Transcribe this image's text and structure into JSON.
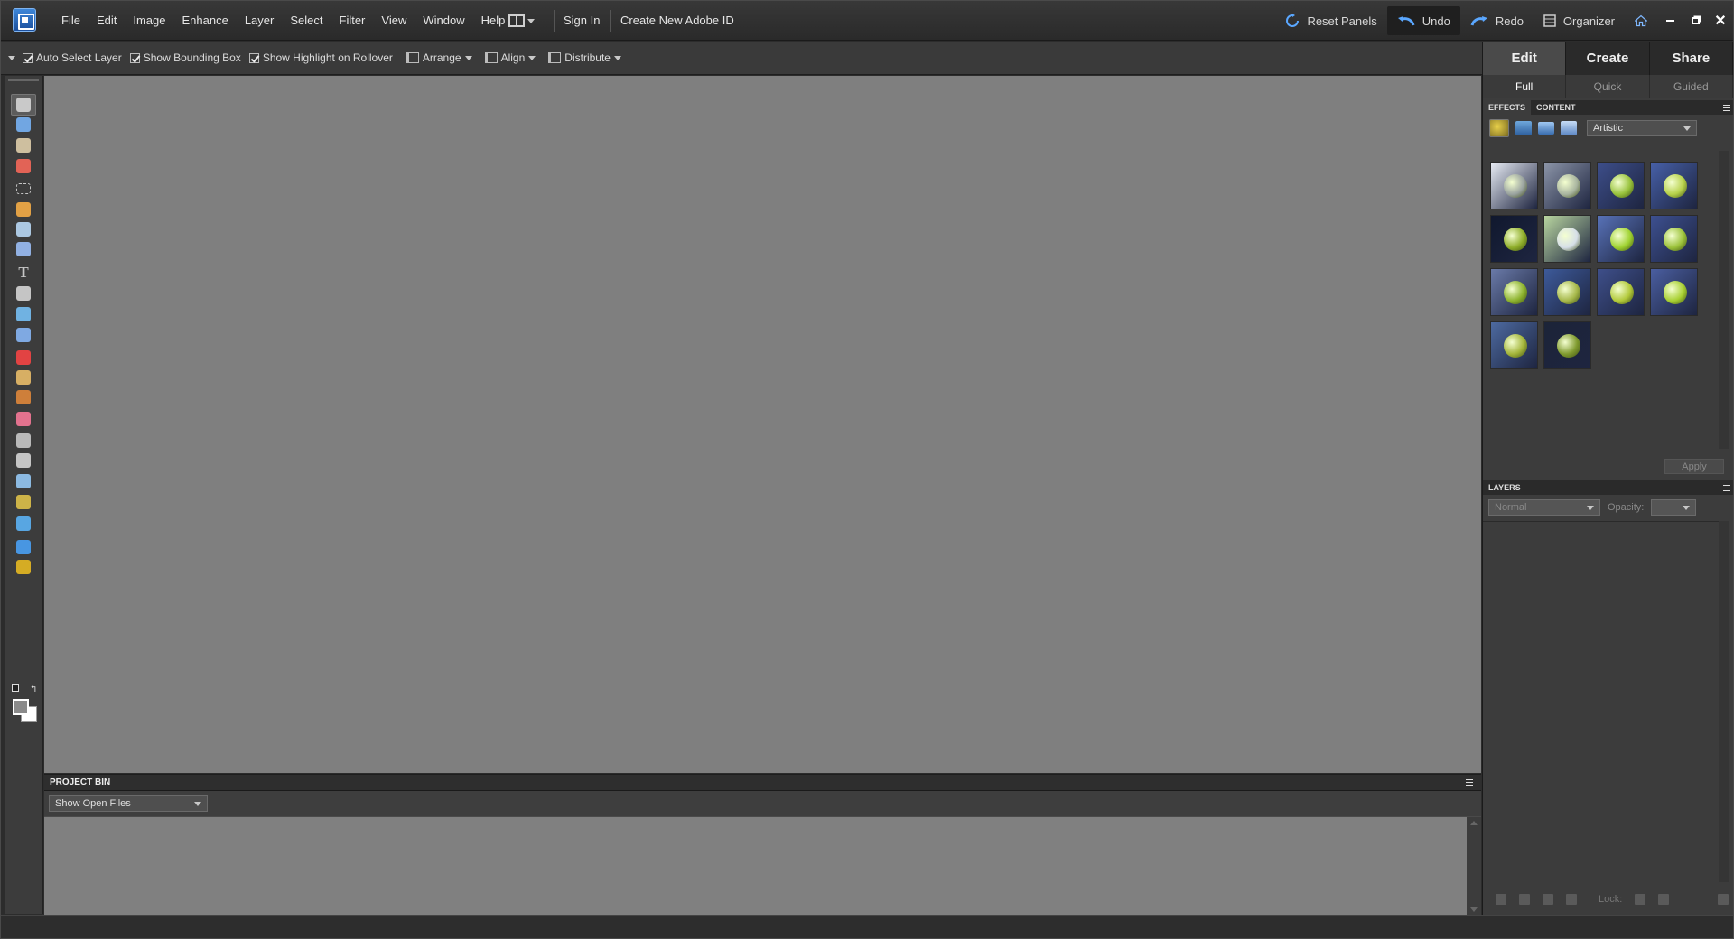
{
  "menubar": {
    "items": [
      "File",
      "Edit",
      "Image",
      "Enhance",
      "Layer",
      "Select",
      "Filter",
      "View",
      "Window",
      "Help"
    ],
    "sign_in": "Sign In",
    "create_id": "Create New Adobe ID",
    "reset_panels": "Reset Panels",
    "undo": "Undo",
    "redo": "Redo",
    "organizer": "Organizer"
  },
  "options_bar": {
    "auto_select_layer": "Auto Select Layer",
    "show_bounding_box": "Show Bounding Box",
    "show_highlight": "Show Highlight on Rollover",
    "arrange": "Arrange",
    "align": "Align",
    "distribute": "Distribute"
  },
  "tools": [
    "move-tool",
    "zoom-tool",
    "hand-tool",
    "eyedropper-tool",
    "marquee-tool",
    "lasso-tool",
    "magic-wand-tool",
    "quick-selection-tool",
    "type-tool",
    "crop-tool",
    "cookie-cutter-tool",
    "recompose-tool",
    "red-eye-tool",
    "spot-healing-tool",
    "clone-stamp-tool",
    "eraser-tool",
    "brush-tool",
    "smart-brush-tool",
    "paint-bucket-tool",
    "gradient-tool",
    "custom-shape-tool",
    "blur-tool",
    "sponge-tool"
  ],
  "project_bin": {
    "title": "PROJECT BIN",
    "filter": "Show Open Files"
  },
  "panel": {
    "modes": [
      "Edit",
      "Create",
      "Share"
    ],
    "active_mode": "Edit",
    "subtabs": [
      "Full",
      "Quick",
      "Guided"
    ],
    "active_subtab": "Full",
    "effects_tab": "EFFECTS",
    "content_tab": "CONTENT",
    "category": "Artistic",
    "apply": "Apply",
    "layers_title": "LAYERS",
    "blend_mode": "Normal",
    "opacity_label": "Opacity:",
    "lock_label": "Lock:"
  },
  "effect_thumbs": [
    {
      "bg": "#e8ecf4",
      "apple": "#9aa3a0"
    },
    {
      "bg": "#8c95a8",
      "apple": "#a9b5a0"
    },
    {
      "bg": "#3d4e8a",
      "apple": "#98c23c"
    },
    {
      "bg": "#4760a8",
      "apple": "#b6d14a"
    },
    {
      "bg": "#10182e",
      "apple": "#8fae2a"
    },
    {
      "bg": "#b9d6a0",
      "apple": "#d6dfe8"
    },
    {
      "bg": "#5872b8",
      "apple": "#9fd230"
    },
    {
      "bg": "#3d5090",
      "apple": "#9bc23a"
    },
    {
      "bg": "#6a7aa8",
      "apple": "#8db32e"
    },
    {
      "bg": "#3d5a9a",
      "apple": "#a6b84a"
    },
    {
      "bg": "#3e4f8a",
      "apple": "#b2c93a"
    },
    {
      "bg": "#4a5ea0",
      "apple": "#a8d032"
    },
    {
      "bg": "#4d6aa0",
      "apple": "#a3b53a"
    },
    {
      "bg": "#1c2438",
      "apple": "#7f9a2e"
    }
  ]
}
